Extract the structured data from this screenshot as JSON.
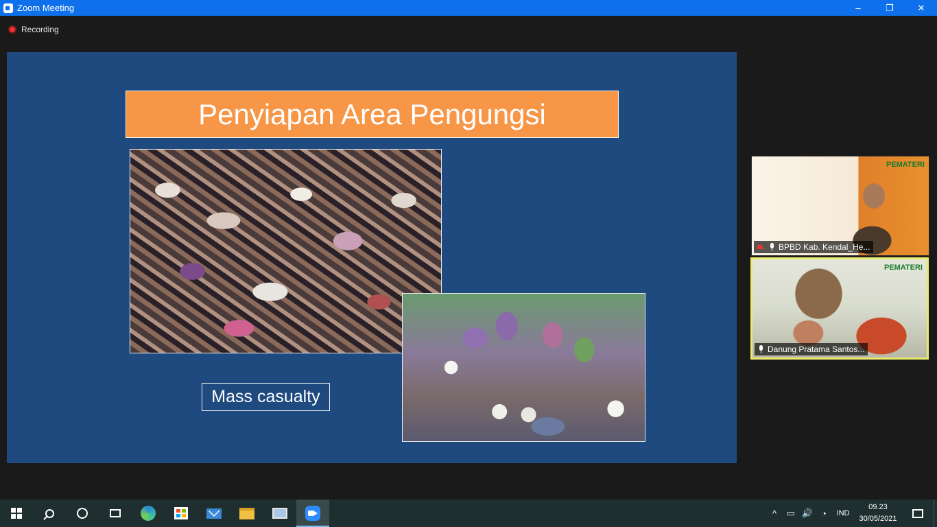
{
  "window": {
    "title": "Zoom Meeting",
    "minimize": "–",
    "maximize": "❐",
    "close": "✕"
  },
  "recording": {
    "label": "Recording"
  },
  "slide": {
    "title": "Penyiapan Area Pengungsi",
    "caption": "Mass casualty",
    "background_color": "#1f4a80",
    "title_color": "#f79646"
  },
  "participants": [
    {
      "name": "BPBD Kab. Kendal_He...",
      "badge": "PEMATERI",
      "video_off": true,
      "muted": true
    },
    {
      "name": "Danung Pratama Santos...",
      "badge": "PEMATERI",
      "muted": true,
      "active_speaker": true
    }
  ],
  "taskbar": {
    "apps": [
      "start",
      "search",
      "cortana",
      "task-view",
      "edge",
      "store",
      "mail",
      "file-explorer",
      "remote-desktop",
      "zoom"
    ],
    "tray": {
      "chevron": "^",
      "battery": "▭",
      "volume": "🔊",
      "network": "◔",
      "language": "IND",
      "time": "09.23",
      "date": "30/05/2021"
    }
  }
}
